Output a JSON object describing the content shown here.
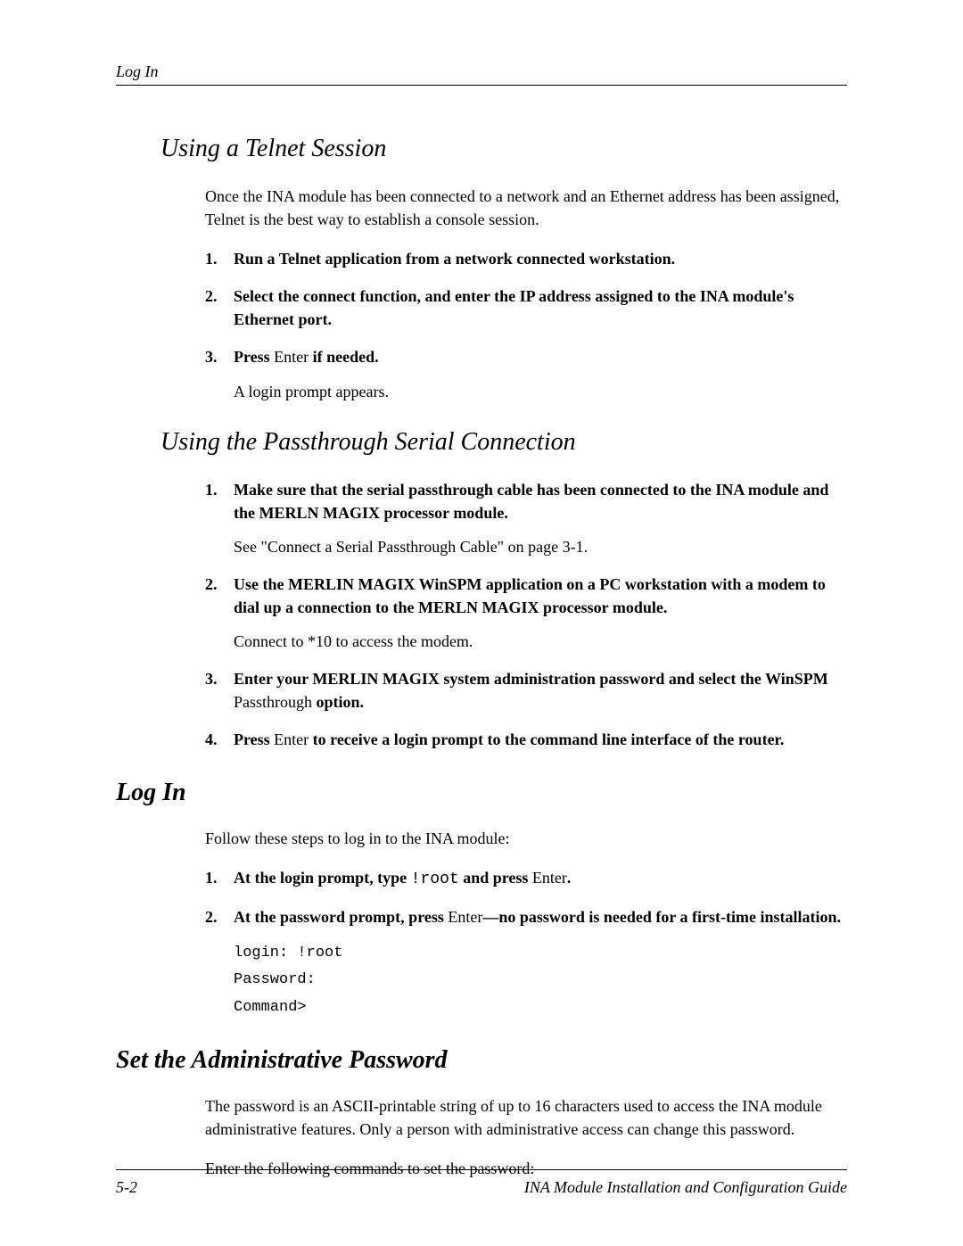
{
  "running_head": "Log In",
  "sections": {
    "telnet": {
      "title": "Using a Telnet Session",
      "intro": "Once the INA module has been connected to a network and an Ethernet address has been assigned, Telnet is the best way to establish a console session.",
      "steps": [
        {
          "text": "Run a Telnet application from a network connected workstation."
        },
        {
          "text": "Select the connect function, and enter the IP address assigned to the INA module's Ethernet port."
        },
        {
          "prefix": "Press ",
          "mid": "Enter",
          "suffix": " if needed.",
          "sub": "A login prompt appears."
        }
      ]
    },
    "passthrough": {
      "title": "Using the Passthrough Serial Connection",
      "steps": [
        {
          "text": "Make sure that the serial passthrough cable has been connected to the INA module and the MERLN MAGIX processor module.",
          "sub": "See \"Connect a Serial Passthrough Cable\" on page 3-1."
        },
        {
          "text": "Use the MERLIN MAGIX WinSPM application on a PC workstation with a modem to dial up a connection to the MERLN MAGIX processor module.",
          "sub": "Connect to *10 to access the modem."
        },
        {
          "prefix": "Enter your MERLIN MAGIX system administration password and select the WinSPM ",
          "mid": "Passthrough",
          "suffix": " option."
        },
        {
          "prefix": "Press ",
          "mid": "Enter",
          "suffix": " to receive a login prompt to the command line interface of the router."
        }
      ]
    },
    "login": {
      "title": "Log In",
      "intro": "Follow these steps to log in to the INA module:",
      "steps": [
        {
          "prefix": "At the login prompt, type ",
          "mid": "!root",
          "suffix_a": " and press ",
          "mid2": "Enter",
          "suffix": "."
        },
        {
          "prefix": "At the password prompt, press ",
          "mid": "Enter",
          "suffix": "—no password is needed for a first-time installation."
        }
      ],
      "code": {
        "l1": "login: !root",
        "l2": "Password:",
        "l3": "Command>"
      }
    },
    "admin_pw": {
      "title": "Set the Administrative Password",
      "p1": "The password is an ASCII-printable string of up to 16 characters used to access the INA module administrative features. Only a person with administrative access can change this password.",
      "p2": "Enter the following commands to set the password:"
    }
  },
  "footer": {
    "page": "5-2",
    "book": "INA Module Installation and Configuration Guide"
  }
}
